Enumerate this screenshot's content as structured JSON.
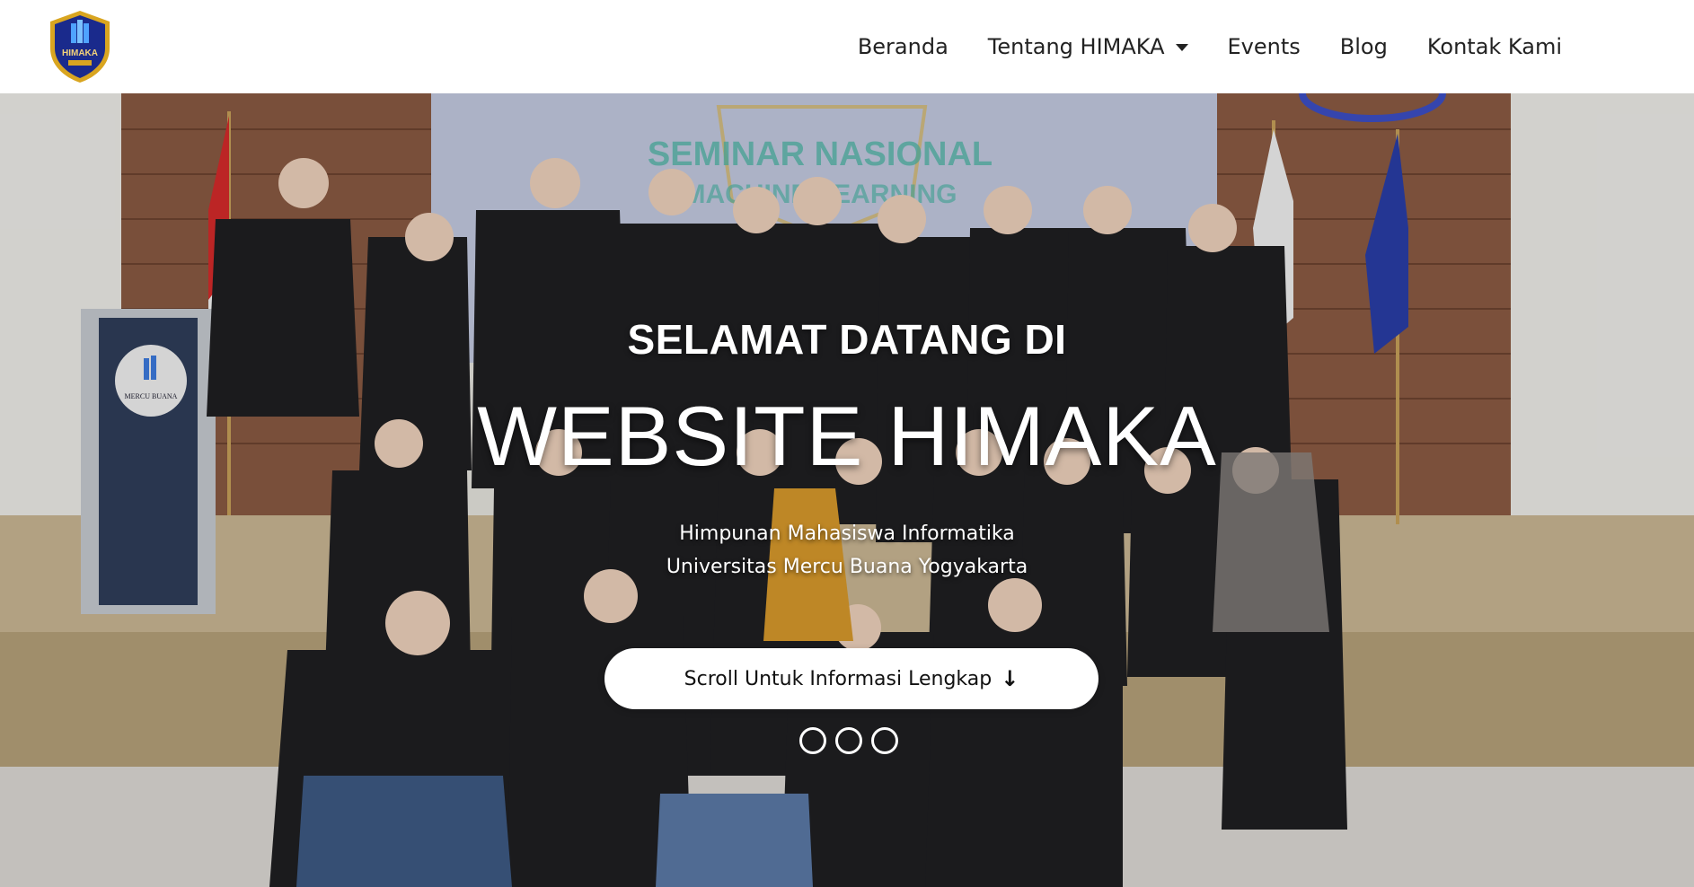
{
  "brand": {
    "logo_text": "HIMAKA"
  },
  "nav": {
    "items": [
      {
        "label": "Beranda",
        "has_dropdown": false
      },
      {
        "label": "Tentang HIMAKA",
        "has_dropdown": true
      },
      {
        "label": "Events",
        "has_dropdown": false
      },
      {
        "label": "Blog",
        "has_dropdown": false
      },
      {
        "label": "Kontak Kami",
        "has_dropdown": false
      }
    ]
  },
  "hero": {
    "kicker": "SELAMAT DATANG DI",
    "title": "WEBSITE HIMAKA",
    "subtitle_line1": "Himpunan Mahasiswa Informatika",
    "subtitle_line2": "Universitas Mercu Buana Yogyakarta",
    "cta_label": "Scroll Untuk Informasi Lengkap",
    "cta_icon": "arrow-down-icon",
    "carousel_dots": 3,
    "background_scene": {
      "screen_text_1": "SEMINAR NASIONAL",
      "screen_text_2": "MACHINE LEARNING",
      "podium_text": "MERCU BUANA"
    }
  },
  "colors": {
    "nav_text": "#222222",
    "hero_text": "#ffffff",
    "logo_blue": "#1a2a8c",
    "logo_gold": "#d9a520"
  }
}
